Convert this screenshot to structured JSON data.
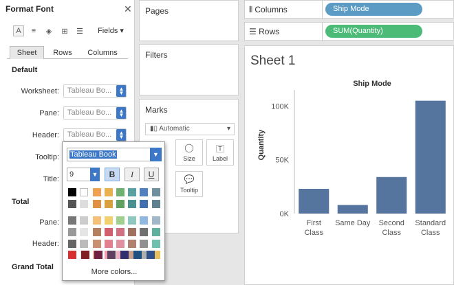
{
  "format_pane": {
    "title": "Format Font",
    "fields_label": "Fields",
    "tabs": [
      "Sheet",
      "Rows",
      "Columns"
    ],
    "default_section": "Default",
    "rows": [
      {
        "label": "Worksheet:",
        "value": "Tableau Bo..."
      },
      {
        "label": "Pane:",
        "value": "Tableau Bo..."
      },
      {
        "label": "Header:",
        "value": "Tableau Bo..."
      },
      {
        "label": "Tooltip:",
        "value": ""
      },
      {
        "label": "Title:",
        "value": ""
      }
    ],
    "total_section": "Total",
    "total_rows": [
      "Pane:",
      "Header:"
    ],
    "grand_total_section": "Grand Total"
  },
  "font_popup": {
    "font_name": "Tableau Book",
    "size": "9",
    "bold_label": "B",
    "italic_label": "I",
    "underline_label": "U",
    "more_colors": "More colors..."
  },
  "panels": {
    "pages": "Pages",
    "filters": "Filters",
    "marks": "Marks",
    "mark_type": "Automatic",
    "mark_buttons": [
      "Size",
      "Label",
      "Tooltip"
    ]
  },
  "shelves": {
    "columns_label": "Columns",
    "columns_pill": "Ship Mode",
    "rows_label": "Rows",
    "rows_pill": "SUM(Quantity)",
    "columns_color": "#5b9bc4",
    "rows_color": "#4dbb78"
  },
  "sheet": {
    "title": "Sheet 1"
  },
  "chart_data": {
    "type": "bar",
    "title": "Ship Mode",
    "ylabel": "Quantity",
    "categories": [
      "First Class",
      "Same Day",
      "Second Class",
      "Standard Class"
    ],
    "values": [
      23000,
      8000,
      34000,
      105000
    ],
    "yticks": [
      {
        "v": 0,
        "label": "0K"
      },
      {
        "v": 50000,
        "label": "50K"
      },
      {
        "v": 100000,
        "label": "100K"
      }
    ],
    "ylim": [
      0,
      115000
    ],
    "bar_color": "#55749e",
    "grid": false
  }
}
